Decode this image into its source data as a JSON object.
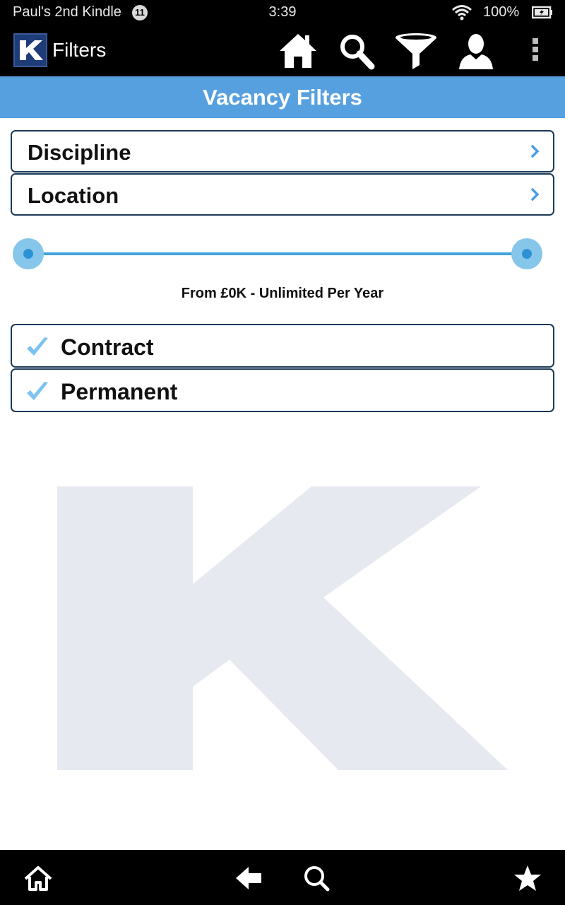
{
  "status_bar": {
    "device_name": "Paul's 2nd Kindle",
    "notification_count": "11",
    "time": "3:39",
    "battery_percent": "100%"
  },
  "app_bar": {
    "logo_letter": "K",
    "title": "Filters",
    "actions": [
      "home-icon",
      "search-icon",
      "filter-icon",
      "profile-icon",
      "overflow-menu-icon"
    ]
  },
  "header": {
    "title": "Vacancy Filters"
  },
  "filters": [
    {
      "label": "Discipline"
    },
    {
      "label": "Location"
    }
  ],
  "salary_slider": {
    "caption": "From £0K  - Unlimited Per Year",
    "min_position": 0,
    "max_position": 1
  },
  "job_types": [
    {
      "label": "Contract",
      "checked": true
    },
    {
      "label": "Permanent",
      "checked": true
    }
  ],
  "bottom_bar": {
    "actions": [
      "home-icon",
      "back-arrow-icon",
      "search-icon",
      "star-icon"
    ]
  },
  "colors": {
    "header_band": "#57a0e0",
    "slider_track": "#3fa3dd",
    "checkmark": "#7cc4f0",
    "watermark": "#e6e9f0"
  }
}
